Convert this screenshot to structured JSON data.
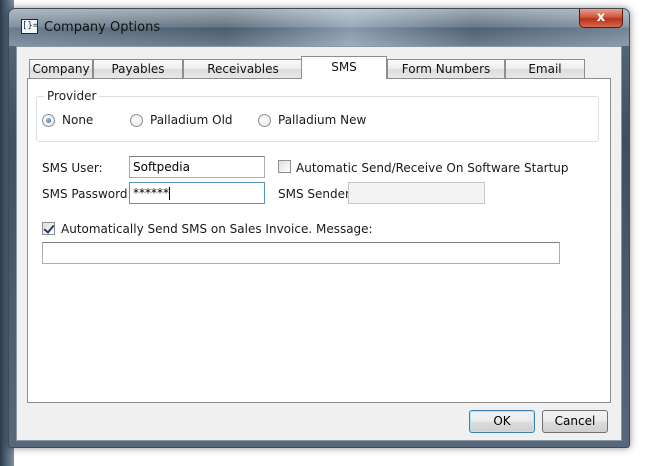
{
  "window": {
    "title": "Company Options",
    "app_icon_glyph": "[}=",
    "close_glyph": "x"
  },
  "tabs": [
    {
      "label": "Company",
      "active": false
    },
    {
      "label": "Payables",
      "active": false
    },
    {
      "label": "Receivables",
      "active": false
    },
    {
      "label": "SMS",
      "active": true
    },
    {
      "label": "Form Numbers",
      "active": false
    },
    {
      "label": "Email",
      "active": false
    }
  ],
  "provider": {
    "legend": "Provider",
    "options": [
      {
        "label": "None",
        "selected": true
      },
      {
        "label": "Palladium Old",
        "selected": false
      },
      {
        "label": "Palladium New",
        "selected": false
      }
    ]
  },
  "sms_user": {
    "label": "SMS User:",
    "value": "Softpedia"
  },
  "sms_password": {
    "label": "SMS Password:",
    "value": "******"
  },
  "auto_send_receive": {
    "label": "Automatic Send/Receive On Software Startup",
    "checked": false
  },
  "sms_sender": {
    "label": "SMS Sender",
    "value": ""
  },
  "auto_send_invoice": {
    "label": "Automatically Send SMS on Sales Invoice. Message:",
    "checked": true
  },
  "message": {
    "value": ""
  },
  "buttons": {
    "ok": "OK",
    "cancel": "Cancel"
  },
  "colors": {
    "default_button_border": "#3c7fb1",
    "close_button": "#c7432b",
    "titlebar": "#56687a"
  },
  "icons": {
    "app": "app-icon",
    "close": "close-icon",
    "checkmark": "checkmark-icon"
  }
}
